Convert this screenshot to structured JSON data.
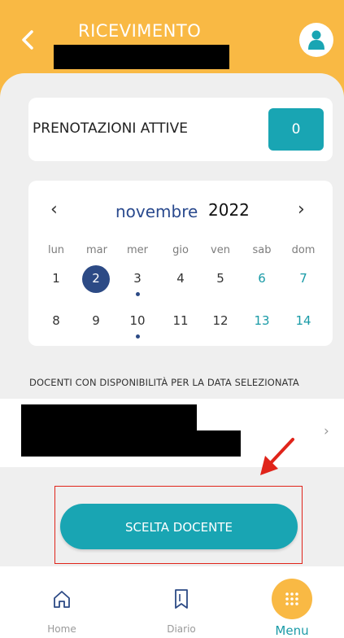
{
  "header": {
    "back_label": "<",
    "title": "RICEVIMENTO",
    "avatar_icon": "user-icon"
  },
  "bookings": {
    "label": "PRENOTAZIONI ATTIVE",
    "count": "0"
  },
  "calendar": {
    "prev": "‹",
    "next": "›",
    "month": "novembre",
    "year": "2022",
    "weekdays": [
      "lun",
      "mar",
      "mer",
      "gio",
      "ven",
      "sab",
      "dom"
    ],
    "week1": [
      "1",
      "2",
      "3",
      "4",
      "5",
      "6",
      "7"
    ],
    "week2": [
      "8",
      "9",
      "10",
      "11",
      "12",
      "13",
      "14"
    ],
    "selected_day": "2",
    "days_with_availability": [
      "3",
      "10"
    ]
  },
  "teachers": {
    "section_label": "DOCENTI CON DISPONIBILITÀ PER LA DATA SELEZIONATA",
    "row_chevron": "›"
  },
  "cta": {
    "label": "SCELTA DOCENTE"
  },
  "nav": {
    "home_label": "Home",
    "diary_label": "Diario",
    "menu_label": "Menu"
  },
  "colors": {
    "accent_yellow": "#f9b944",
    "teal": "#19a5b3",
    "selected_day": "#2c4a85",
    "annotation_red": "#e0241a"
  }
}
